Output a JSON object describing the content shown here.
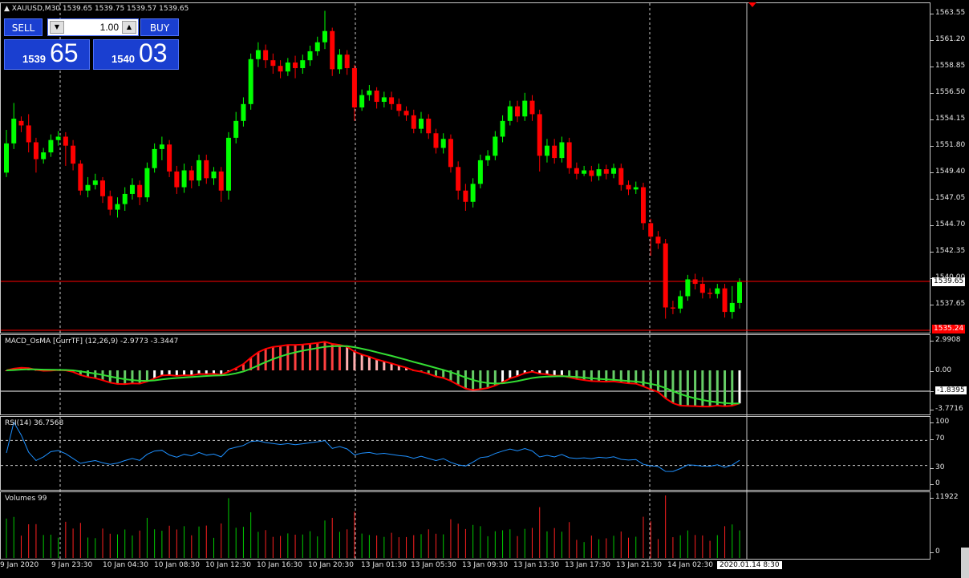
{
  "symbol_header": "XAUUSD,M30  1539.65 1539.75 1539.57 1539.65",
  "trade_panel": {
    "sell_label": "SELL",
    "buy_label": "BUY",
    "lot_value": "1.00",
    "down_arrow": "▼",
    "up_arrow": "▲",
    "sell_price_small": "1539",
    "sell_price_large": "65",
    "buy_price_small": "1540",
    "buy_price_large": "03"
  },
  "price_axis": {
    "ticks": [
      "1563.55",
      "1561.20",
      "1558.85",
      "1556.50",
      "1554.15",
      "1551.80",
      "1549.40",
      "1547.05",
      "1544.70",
      "1542.35",
      "1540.00",
      "1537.65"
    ],
    "current_price_tag": "1539.65",
    "lower_tag": "1535.24"
  },
  "macd": {
    "label": "MACD_OsMA [CurrTF] (12,26,9) -2.9773 -3.3447",
    "ticks": [
      "2.9908",
      "0.00",
      "-1.8395",
      "-3.7716"
    ]
  },
  "rsi": {
    "label": "RSI(14) 36.7568",
    "ticks": [
      "100",
      "70",
      "30",
      "0"
    ]
  },
  "volumes": {
    "label": "Volumes 99",
    "ticks": [
      "11922",
      "0"
    ]
  },
  "time_axis": [
    "9 Jan 2020",
    "9 Jan 23:30",
    "10 Jan 04:30",
    "10 Jan 08:30",
    "10 Jan 12:30",
    "10 Jan 16:30",
    "10 Jan 20:30",
    "13 Jan 01:30",
    "13 Jan 05:30",
    "13 Jan 09:30",
    "13 Jan 13:30",
    "13 Jan 17:30",
    "13 Jan 21:30",
    "14 Jan 02:30"
  ],
  "time_cursor_label": "2020.01.14 8:30",
  "chart_data": {
    "type": "candlestick",
    "title": "XAUUSD,M30",
    "ylim": [
      1535.0,
      1564.0
    ],
    "bull_color": "#00ff00",
    "bear_color": "#ff0000",
    "candles": [
      [
        1549.4,
        1552.0,
        1549.0,
        1553.2
      ],
      [
        1552.0,
        1554.2,
        1551.5,
        1555.6
      ],
      [
        1554.0,
        1553.6,
        1553.0,
        1554.4
      ],
      [
        1553.6,
        1552.1,
        1551.2,
        1554.6
      ],
      [
        1552.1,
        1550.6,
        1549.4,
        1552.5
      ],
      [
        1550.6,
        1551.2,
        1550.2,
        1551.6
      ],
      [
        1551.2,
        1552.3,
        1550.8,
        1552.8
      ],
      [
        1552.3,
        1552.6,
        1551.8,
        1553.1
      ],
      [
        1552.6,
        1551.8,
        1550.0,
        1553.0
      ],
      [
        1551.8,
        1550.2,
        1549.6,
        1552.3
      ],
      [
        1550.2,
        1547.8,
        1547.4,
        1550.5
      ],
      [
        1547.8,
        1548.3,
        1547.2,
        1549.0
      ],
      [
        1548.3,
        1548.7,
        1547.9,
        1549.3
      ],
      [
        1548.7,
        1547.3,
        1546.7,
        1549.0
      ],
      [
        1547.3,
        1546.1,
        1545.6,
        1547.8
      ],
      [
        1546.1,
        1546.6,
        1545.4,
        1547.2
      ],
      [
        1546.6,
        1547.5,
        1546.0,
        1548.1
      ],
      [
        1547.5,
        1548.3,
        1547.0,
        1548.9
      ],
      [
        1548.3,
        1547.2,
        1546.5,
        1548.7
      ],
      [
        1547.2,
        1549.8,
        1546.8,
        1550.3
      ],
      [
        1549.8,
        1551.5,
        1549.4,
        1552.0
      ],
      [
        1551.5,
        1551.9,
        1550.5,
        1552.6
      ],
      [
        1551.9,
        1549.5,
        1549.0,
        1552.3
      ],
      [
        1549.5,
        1548.1,
        1547.5,
        1550.0
      ],
      [
        1548.1,
        1549.6,
        1547.6,
        1550.2
      ],
      [
        1549.6,
        1548.7,
        1548.0,
        1550.0
      ],
      [
        1548.7,
        1550.5,
        1548.2,
        1551.0
      ],
      [
        1550.5,
        1548.9,
        1548.4,
        1551.0
      ],
      [
        1548.9,
        1549.5,
        1548.3,
        1549.9
      ],
      [
        1549.5,
        1547.8,
        1546.8,
        1549.9
      ],
      [
        1547.8,
        1552.5,
        1547.0,
        1553.0
      ],
      [
        1552.5,
        1554.0,
        1552.0,
        1554.8
      ],
      [
        1554.0,
        1555.5,
        1553.5,
        1556.1
      ],
      [
        1555.5,
        1559.5,
        1555.0,
        1560.0
      ],
      [
        1559.5,
        1560.3,
        1558.8,
        1561.0
      ],
      [
        1560.3,
        1559.4,
        1558.7,
        1560.8
      ],
      [
        1559.4,
        1558.9,
        1558.2,
        1560.0
      ],
      [
        1558.9,
        1558.4,
        1557.8,
        1559.4
      ],
      [
        1558.4,
        1559.2,
        1558.0,
        1559.6
      ],
      [
        1559.2,
        1558.7,
        1557.8,
        1559.8
      ],
      [
        1558.7,
        1559.4,
        1558.2,
        1559.9
      ],
      [
        1559.4,
        1560.2,
        1558.9,
        1560.7
      ],
      [
        1560.2,
        1561.0,
        1559.8,
        1561.5
      ],
      [
        1561.0,
        1562.0,
        1560.4,
        1563.8
      ],
      [
        1562.0,
        1558.6,
        1558.0,
        1562.3
      ],
      [
        1558.6,
        1559.9,
        1558.2,
        1560.4
      ],
      [
        1559.9,
        1558.7,
        1558.1,
        1560.3
      ],
      [
        1558.7,
        1555.2,
        1554.0,
        1559.0
      ],
      [
        1555.2,
        1556.3,
        1554.9,
        1556.8
      ],
      [
        1556.3,
        1556.7,
        1555.8,
        1557.2
      ],
      [
        1556.7,
        1555.7,
        1555.1,
        1557.0
      ],
      [
        1555.7,
        1556.1,
        1555.2,
        1556.6
      ],
      [
        1556.1,
        1555.5,
        1555.0,
        1556.6
      ],
      [
        1555.5,
        1554.9,
        1554.4,
        1556.0
      ],
      [
        1554.9,
        1554.5,
        1554.0,
        1555.3
      ],
      [
        1554.5,
        1553.3,
        1552.9,
        1555.0
      ],
      [
        1553.3,
        1554.2,
        1552.9,
        1554.8
      ],
      [
        1554.2,
        1552.9,
        1552.4,
        1554.6
      ],
      [
        1552.9,
        1551.6,
        1551.1,
        1553.3
      ],
      [
        1551.6,
        1552.4,
        1551.1,
        1552.9
      ],
      [
        1552.4,
        1549.9,
        1549.4,
        1552.8
      ],
      [
        1549.9,
        1547.8,
        1547.0,
        1550.4
      ],
      [
        1547.8,
        1546.8,
        1546.0,
        1548.4
      ],
      [
        1546.8,
        1548.4,
        1546.3,
        1548.9
      ],
      [
        1548.4,
        1550.5,
        1548.0,
        1551.0
      ],
      [
        1550.5,
        1550.9,
        1550.0,
        1551.4
      ],
      [
        1550.9,
        1552.6,
        1550.5,
        1553.1
      ],
      [
        1552.6,
        1554.0,
        1552.1,
        1554.5
      ],
      [
        1554.0,
        1555.3,
        1553.6,
        1555.8
      ],
      [
        1555.3,
        1554.4,
        1553.9,
        1555.8
      ],
      [
        1554.4,
        1555.8,
        1554.0,
        1556.5
      ],
      [
        1555.8,
        1554.6,
        1554.0,
        1556.3
      ],
      [
        1554.6,
        1550.9,
        1549.5,
        1555.0
      ],
      [
        1550.9,
        1551.8,
        1550.3,
        1552.4
      ],
      [
        1551.8,
        1550.7,
        1550.2,
        1552.4
      ],
      [
        1550.7,
        1552.1,
        1550.3,
        1552.6
      ],
      [
        1552.1,
        1549.8,
        1549.3,
        1552.5
      ],
      [
        1549.8,
        1549.3,
        1548.8,
        1550.3
      ],
      [
        1549.3,
        1549.6,
        1549.1,
        1550.0
      ],
      [
        1549.6,
        1549.1,
        1548.6,
        1550.0
      ],
      [
        1549.1,
        1549.7,
        1548.7,
        1550.2
      ],
      [
        1549.7,
        1549.3,
        1548.8,
        1550.1
      ],
      [
        1549.3,
        1549.8,
        1548.9,
        1550.2
      ],
      [
        1549.8,
        1548.3,
        1547.8,
        1550.2
      ],
      [
        1548.3,
        1547.9,
        1547.4,
        1548.7
      ],
      [
        1547.9,
        1548.1,
        1547.5,
        1548.6
      ],
      [
        1548.1,
        1544.9,
        1544.3,
        1548.5
      ],
      [
        1544.9,
        1543.7,
        1542.0,
        1545.3
      ],
      [
        1543.7,
        1543.1,
        1542.6,
        1544.2
      ],
      [
        1543.1,
        1537.4,
        1536.4,
        1543.5
      ],
      [
        1537.4,
        1537.3,
        1536.8,
        1538.0
      ],
      [
        1537.3,
        1538.4,
        1536.9,
        1538.9
      ],
      [
        1538.4,
        1539.9,
        1538.0,
        1540.3
      ],
      [
        1539.9,
        1539.5,
        1539.0,
        1540.4
      ],
      [
        1539.5,
        1538.7,
        1538.2,
        1540.1
      ],
      [
        1538.7,
        1538.6,
        1538.2,
        1539.1
      ],
      [
        1538.6,
        1539.1,
        1538.2,
        1539.5
      ],
      [
        1539.1,
        1537.0,
        1536.5,
        1539.5
      ],
      [
        1537.0,
        1537.8,
        1536.4,
        1539.3
      ],
      [
        1537.8,
        1539.65,
        1537.3,
        1540.0
      ]
    ]
  }
}
